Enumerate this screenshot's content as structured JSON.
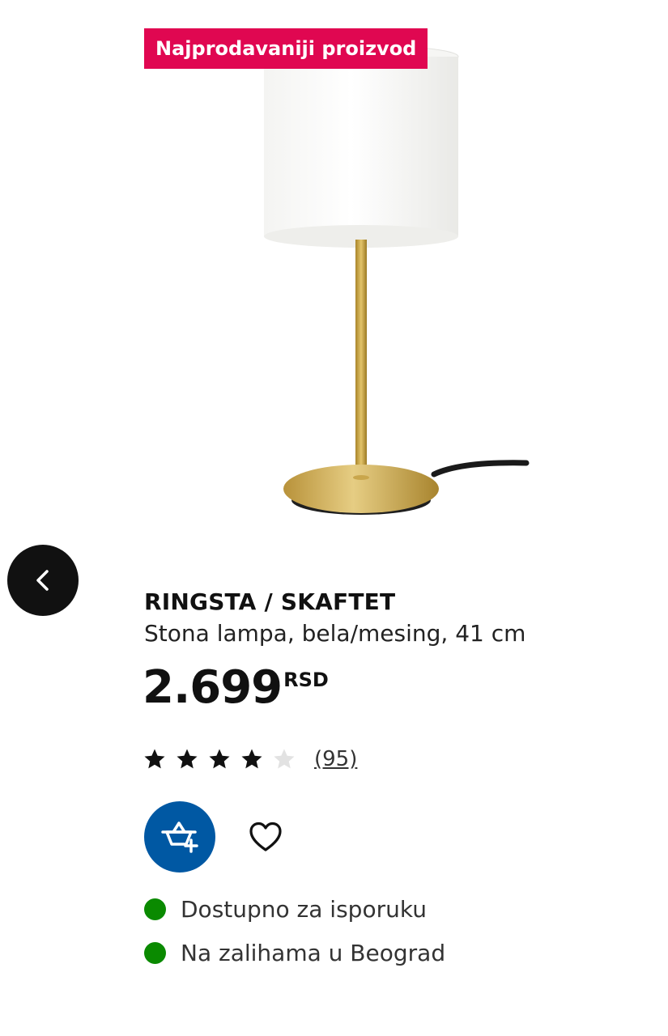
{
  "badge": {
    "label": "Najprodavaniji proizvod"
  },
  "product": {
    "name": "RINGSTA / SKAFTET",
    "description": "Stona lampa, bela/mesing, 41 cm",
    "price": {
      "amount": "2.699",
      "currency": "RSD"
    },
    "rating": {
      "stars": 4,
      "max_stars": 5,
      "review_count": "(95)"
    }
  },
  "availability": [
    {
      "label": "Dostupno za isporuku",
      "status_color": "#0a8a00"
    },
    {
      "label": "Na zalihama u Beograd",
      "status_color": "#0a8a00"
    }
  ],
  "icons": {
    "back": "chevron-left-icon",
    "cart": "add-to-cart-icon",
    "favourite": "heart-outline-icon"
  },
  "colors": {
    "badge_background": "#e00751",
    "primary_button": "#0058a3",
    "back_button": "#111111",
    "in_stock": "#0a8a00"
  }
}
